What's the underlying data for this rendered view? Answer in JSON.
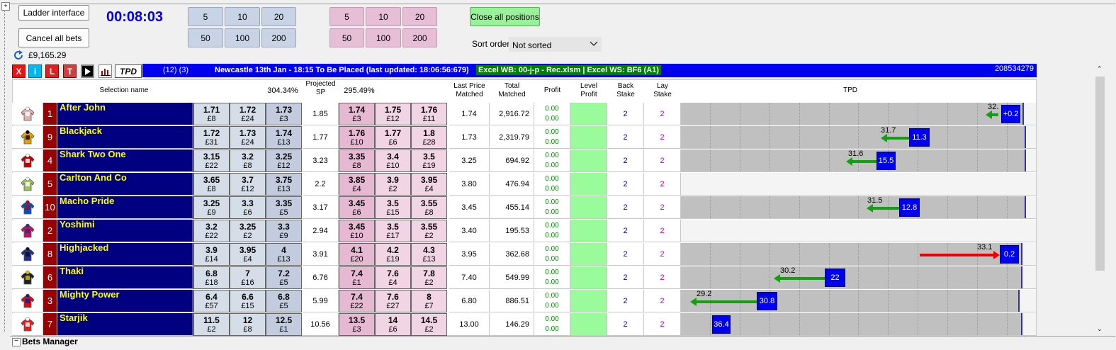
{
  "toolbar": {
    "ladder_label": "Ladder interface",
    "cancel_label": "Cancel all bets",
    "timer": "00:08:03",
    "balance": "£9,165.29",
    "back_stakes": [
      "5",
      "10",
      "20",
      "50",
      "100",
      "200"
    ],
    "lay_stakes": [
      "5",
      "10",
      "20",
      "50",
      "100",
      "200"
    ],
    "close_label": "Close all positions",
    "sort_label": "Sort order",
    "sort_value": "Not sorted"
  },
  "buttons": {
    "x": "X",
    "i": "i",
    "l": "L",
    "t": "T",
    "tpd": "TPD"
  },
  "market": {
    "counts": "(12) (3)",
    "title": "Newcastle 13th Jan - 18:15 To Be Placed (last updated: 18:06:56:679)",
    "excel": "Excel WB: 00-j-p - Rec.xlsm | Excel WS: BF6 (A1)",
    "market_id": "208534279"
  },
  "headers": {
    "selection": "Selection name",
    "back_pct": "304.34%",
    "proj_sp_1": "Projected",
    "proj_sp_2": "SP",
    "lay_pct": "295.49%",
    "lpm_1": "Last Price",
    "lpm_2": "Matched",
    "tm_1": "Total",
    "tm_2": "Matched",
    "profit": "Profit",
    "lvl_1": "Level",
    "lvl_2": "Profit",
    "bs_1": "Back",
    "bs_2": "Stake",
    "ls_1": "Lay",
    "ls_2": "Stake",
    "tpd": "TPD"
  },
  "rows": [
    {
      "num": "1",
      "name": "After John",
      "back": [
        [
          "1.71",
          "£8"
        ],
        [
          "1.72",
          "£24"
        ],
        [
          "1.73",
          "£3"
        ]
      ],
      "sp": "1.85",
      "lay": [
        [
          "1.74",
          "£3"
        ],
        [
          "1.75",
          "£12"
        ],
        [
          "1.76",
          "£11"
        ]
      ],
      "lpm": "1.74",
      "tm": "2,916.72",
      "p1": "0.00",
      "p2": "0.00",
      "bs": "2",
      "ls": "2",
      "tpd_label": "32.",
      "tpd_value": "+0.2"
    },
    {
      "num": "9",
      "name": "Blackjack",
      "back": [
        [
          "1.72",
          "£31"
        ],
        [
          "1.73",
          "£24"
        ],
        [
          "1.74",
          "£13"
        ]
      ],
      "sp": "1.77",
      "lay": [
        [
          "1.76",
          "£10"
        ],
        [
          "1.77",
          "£6"
        ],
        [
          "1.8",
          "£28"
        ]
      ],
      "lpm": "1.73",
      "tm": "2,319.79",
      "p1": "0.00",
      "p2": "0.00",
      "bs": "2",
      "ls": "2",
      "tpd_label": "31.7",
      "tpd_value": "11.3"
    },
    {
      "num": "4",
      "name": "Shark Two One",
      "back": [
        [
          "3.15",
          "£22"
        ],
        [
          "3.2",
          "£8"
        ],
        [
          "3.25",
          "£12"
        ]
      ],
      "sp": "3.23",
      "lay": [
        [
          "3.35",
          "£8"
        ],
        [
          "3.4",
          "£10"
        ],
        [
          "3.5",
          "£19"
        ]
      ],
      "lpm": "3.25",
      "tm": "694.92",
      "p1": "0.00",
      "p2": "0.00",
      "bs": "2",
      "ls": "2",
      "tpd_label": "31.6",
      "tpd_value": "15.5"
    },
    {
      "num": "5",
      "name": "Carlton And Co",
      "back": [
        [
          "3.65",
          "£8"
        ],
        [
          "3.7",
          "£12"
        ],
        [
          "3.75",
          "£13"
        ]
      ],
      "sp": "2.2",
      "lay": [
        [
          "3.85",
          "£4"
        ],
        [
          "3.9",
          "£2"
        ],
        [
          "3.95",
          "£4"
        ]
      ],
      "lpm": "3.80",
      "tm": "476.94",
      "p1": "0.00",
      "p2": "0.00",
      "bs": "2",
      "ls": "2",
      "tpd_label": "",
      "tpd_value": ""
    },
    {
      "num": "10",
      "name": "Macho Pride",
      "back": [
        [
          "3.25",
          "£9"
        ],
        [
          "3.3",
          "£6"
        ],
        [
          "3.35",
          "£5"
        ]
      ],
      "sp": "3.17",
      "lay": [
        [
          "3.45",
          "£6"
        ],
        [
          "3.5",
          "£15"
        ],
        [
          "3.55",
          "£8"
        ]
      ],
      "lpm": "3.45",
      "tm": "455.14",
      "p1": "0.00",
      "p2": "0.00",
      "bs": "2",
      "ls": "2",
      "tpd_label": "31.5",
      "tpd_value": "12.8"
    },
    {
      "num": "2",
      "name": "Yoshimi",
      "back": [
        [
          "3.2",
          "£22"
        ],
        [
          "3.25",
          "£2"
        ],
        [
          "3.3",
          "£9"
        ]
      ],
      "sp": "2.94",
      "lay": [
        [
          "3.45",
          "£10"
        ],
        [
          "3.5",
          "£17"
        ],
        [
          "3.55",
          "£2"
        ]
      ],
      "lpm": "3.40",
      "tm": "195.53",
      "p1": "0.00",
      "p2": "0.00",
      "bs": "2",
      "ls": "2",
      "tpd_label": "",
      "tpd_value": ""
    },
    {
      "num": "8",
      "name": "Highjacked",
      "back": [
        [
          "3.9",
          "£14"
        ],
        [
          "3.95",
          "£4"
        ],
        [
          "4",
          "£13"
        ]
      ],
      "sp": "3.91",
      "lay": [
        [
          "4.1",
          "£20"
        ],
        [
          "4.2",
          "£19"
        ],
        [
          "4.3",
          "£13"
        ]
      ],
      "lpm": "3.95",
      "tm": "362.68",
      "p1": "0.00",
      "p2": "0.00",
      "bs": "2",
      "ls": "2",
      "tpd_label": "33.1",
      "tpd_value": "0.2"
    },
    {
      "num": "6",
      "name": "Thaki",
      "back": [
        [
          "6.8",
          "£18"
        ],
        [
          "7",
          "£16"
        ],
        [
          "7.2",
          "£5"
        ]
      ],
      "sp": "6.76",
      "lay": [
        [
          "7.4",
          "£1"
        ],
        [
          "7.6",
          "£4"
        ],
        [
          "7.8",
          "£2"
        ]
      ],
      "lpm": "7.40",
      "tm": "549.99",
      "p1": "0.00",
      "p2": "0.00",
      "bs": "2",
      "ls": "2",
      "tpd_label": "30.2",
      "tpd_value": "22"
    },
    {
      "num": "3",
      "name": "Mighty Power",
      "back": [
        [
          "6.4",
          "£57"
        ],
        [
          "6.6",
          "£15"
        ],
        [
          "6.8",
          "£5"
        ]
      ],
      "sp": "5.99",
      "lay": [
        [
          "7.4",
          "£22"
        ],
        [
          "7.6",
          "£27"
        ],
        [
          "8",
          "£7"
        ]
      ],
      "lpm": "6.80",
      "tm": "886.51",
      "p1": "0.00",
      "p2": "0.00",
      "bs": "2",
      "ls": "2",
      "tpd_label": "29.2",
      "tpd_value": "30.8"
    },
    {
      "num": "7",
      "name": "Starjik",
      "back": [
        [
          "11.5",
          "£2"
        ],
        [
          "12",
          "£8"
        ],
        [
          "12.5",
          "£1"
        ]
      ],
      "sp": "10.56",
      "lay": [
        [
          "13.5",
          "£3"
        ],
        [
          "14",
          "£6"
        ],
        [
          "14.5",
          "£2"
        ]
      ],
      "lpm": "13.00",
      "tm": "146.29",
      "p1": "0.00",
      "p2": "0.00",
      "bs": "2",
      "ls": "2",
      "tpd_label": "",
      "tpd_value": "36.4"
    }
  ],
  "bets_manager": "Bets Manager",
  "colors": {
    "name_bg": "#000080",
    "name_text": "#ffff00",
    "number_bg": "#990000",
    "info_bar": "#0000f0",
    "back_price": "#c2ccde",
    "lay_price": "#e6b8d2",
    "level_profit": "#99fb99",
    "tpd_bar": "#0000f0",
    "arrow_green": "#10a010",
    "arrow_red": "#f00000"
  }
}
